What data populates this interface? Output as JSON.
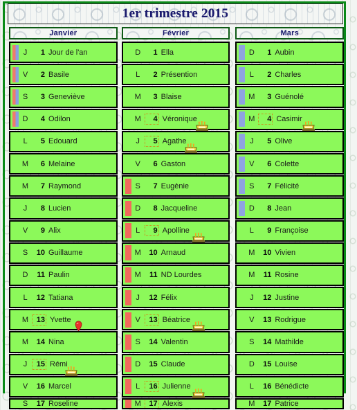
{
  "page": {
    "title": "1er trimestre 2015",
    "frame_color": "#0a8a18",
    "row_color": "#8cf95a",
    "title_color": "#1b1b6e"
  },
  "months": [
    {
      "name": "Janvier",
      "bar_style": "rb",
      "days": [
        {
          "dow": "J",
          "num": "1",
          "saint": "Jour de l'an",
          "bar": "rb",
          "selected": false,
          "icon": ""
        },
        {
          "dow": "V",
          "num": "2",
          "saint": "Basile",
          "bar": "rb",
          "selected": false,
          "icon": ""
        },
        {
          "dow": "S",
          "num": "3",
          "saint": "Geneviève",
          "bar": "rb",
          "selected": false,
          "icon": ""
        },
        {
          "dow": "D",
          "num": "4",
          "saint": "Odilon",
          "bar": "rb",
          "selected": false,
          "icon": ""
        },
        {
          "dow": "L",
          "num": "5",
          "saint": "Edouard",
          "bar": "none",
          "selected": false,
          "icon": ""
        },
        {
          "dow": "M",
          "num": "6",
          "saint": "Melaine",
          "bar": "none",
          "selected": false,
          "icon": ""
        },
        {
          "dow": "M",
          "num": "7",
          "saint": "Raymond",
          "bar": "none",
          "selected": false,
          "icon": ""
        },
        {
          "dow": "J",
          "num": "8",
          "saint": "Lucien",
          "bar": "none",
          "selected": false,
          "icon": ""
        },
        {
          "dow": "V",
          "num": "9",
          "saint": "Alix",
          "bar": "none",
          "selected": false,
          "icon": ""
        },
        {
          "dow": "S",
          "num": "10",
          "saint": "Guillaume",
          "bar": "none",
          "selected": false,
          "icon": ""
        },
        {
          "dow": "D",
          "num": "11",
          "saint": "Paulin",
          "bar": "none",
          "selected": false,
          "icon": ""
        },
        {
          "dow": "L",
          "num": "12",
          "saint": "Tatiana",
          "bar": "none",
          "selected": false,
          "icon": ""
        },
        {
          "dow": "M",
          "num": "13",
          "saint": "Yvette",
          "bar": "none",
          "selected": true,
          "icon": "map-pin"
        },
        {
          "dow": "M",
          "num": "14",
          "saint": "Nina",
          "bar": "none",
          "selected": false,
          "icon": ""
        },
        {
          "dow": "J",
          "num": "15",
          "saint": "Rémi",
          "bar": "none",
          "selected": true,
          "icon": "birthday-cake"
        },
        {
          "dow": "V",
          "num": "16",
          "saint": "Marcel",
          "bar": "none",
          "selected": false,
          "icon": ""
        },
        {
          "dow": "S",
          "num": "17",
          "saint": "Roseline",
          "bar": "none",
          "selected": false,
          "icon": ""
        }
      ]
    },
    {
      "name": "Février",
      "bar_style": "r",
      "days": [
        {
          "dow": "D",
          "num": "1",
          "saint": "Ella",
          "bar": "none",
          "selected": false,
          "icon": ""
        },
        {
          "dow": "L",
          "num": "2",
          "saint": "Présention",
          "bar": "none",
          "selected": false,
          "icon": ""
        },
        {
          "dow": "M",
          "num": "3",
          "saint": "Blaise",
          "bar": "none",
          "selected": false,
          "icon": ""
        },
        {
          "dow": "M",
          "num": "4",
          "saint": "Véronique",
          "bar": "none",
          "selected": true,
          "icon": "birthday-cake"
        },
        {
          "dow": "J",
          "num": "5",
          "saint": "Agathe",
          "bar": "none",
          "selected": true,
          "icon": "birthday-cake"
        },
        {
          "dow": "V",
          "num": "6",
          "saint": "Gaston",
          "bar": "none",
          "selected": false,
          "icon": ""
        },
        {
          "dow": "S",
          "num": "7",
          "saint": "Eugènie",
          "bar": "r",
          "selected": false,
          "icon": ""
        },
        {
          "dow": "D",
          "num": "8",
          "saint": "Jacqueline",
          "bar": "r",
          "selected": false,
          "icon": ""
        },
        {
          "dow": "L",
          "num": "9",
          "saint": "Apolline",
          "bar": "r",
          "selected": true,
          "icon": "birthday-cake"
        },
        {
          "dow": "M",
          "num": "10",
          "saint": "Arnaud",
          "bar": "r",
          "selected": false,
          "icon": ""
        },
        {
          "dow": "M",
          "num": "11",
          "saint": "ND Lourdes",
          "bar": "r",
          "selected": false,
          "icon": ""
        },
        {
          "dow": "J",
          "num": "12",
          "saint": "Félix",
          "bar": "r",
          "selected": false,
          "icon": ""
        },
        {
          "dow": "V",
          "num": "13",
          "saint": "Béatrice",
          "bar": "r",
          "selected": true,
          "icon": "birthday-cake"
        },
        {
          "dow": "S",
          "num": "14",
          "saint": "Valentin",
          "bar": "r",
          "selected": false,
          "icon": ""
        },
        {
          "dow": "D",
          "num": "15",
          "saint": "Claude",
          "bar": "r",
          "selected": false,
          "icon": ""
        },
        {
          "dow": "L",
          "num": "16",
          "saint": "Julienne",
          "bar": "r",
          "selected": true,
          "icon": "birthday-cake"
        },
        {
          "dow": "M",
          "num": "17",
          "saint": "Alexis",
          "bar": "r",
          "selected": true,
          "icon": ""
        }
      ]
    },
    {
      "name": "Mars",
      "bar_style": "b",
      "days": [
        {
          "dow": "D",
          "num": "1",
          "saint": "Aubin",
          "bar": "b",
          "selected": false,
          "icon": ""
        },
        {
          "dow": "L",
          "num": "2",
          "saint": "Charles",
          "bar": "b",
          "selected": false,
          "icon": ""
        },
        {
          "dow": "M",
          "num": "3",
          "saint": "Guénolé",
          "bar": "b",
          "selected": false,
          "icon": ""
        },
        {
          "dow": "M",
          "num": "4",
          "saint": "Casimir",
          "bar": "b",
          "selected": true,
          "icon": "birthday-cake"
        },
        {
          "dow": "J",
          "num": "5",
          "saint": "Olive",
          "bar": "b",
          "selected": false,
          "icon": ""
        },
        {
          "dow": "V",
          "num": "6",
          "saint": "Colette",
          "bar": "b",
          "selected": false,
          "icon": ""
        },
        {
          "dow": "S",
          "num": "7",
          "saint": "Félicité",
          "bar": "b",
          "selected": false,
          "icon": ""
        },
        {
          "dow": "D",
          "num": "8",
          "saint": "Jean",
          "bar": "b",
          "selected": false,
          "icon": ""
        },
        {
          "dow": "L",
          "num": "9",
          "saint": "Françoise",
          "bar": "none",
          "selected": false,
          "icon": ""
        },
        {
          "dow": "M",
          "num": "10",
          "saint": "Vivien",
          "bar": "none",
          "selected": false,
          "icon": ""
        },
        {
          "dow": "M",
          "num": "11",
          "saint": "Rosine",
          "bar": "none",
          "selected": false,
          "icon": ""
        },
        {
          "dow": "J",
          "num": "12",
          "saint": "Justine",
          "bar": "none",
          "selected": false,
          "icon": ""
        },
        {
          "dow": "V",
          "num": "13",
          "saint": "Rodrigue",
          "bar": "none",
          "selected": false,
          "icon": ""
        },
        {
          "dow": "S",
          "num": "14",
          "saint": "Mathilde",
          "bar": "none",
          "selected": false,
          "icon": ""
        },
        {
          "dow": "D",
          "num": "15",
          "saint": "Louise",
          "bar": "none",
          "selected": false,
          "icon": ""
        },
        {
          "dow": "L",
          "num": "16",
          "saint": "Bénédicte",
          "bar": "none",
          "selected": false,
          "icon": ""
        },
        {
          "dow": "M",
          "num": "17",
          "saint": "Patrice",
          "bar": "none",
          "selected": false,
          "icon": ""
        }
      ]
    }
  ]
}
